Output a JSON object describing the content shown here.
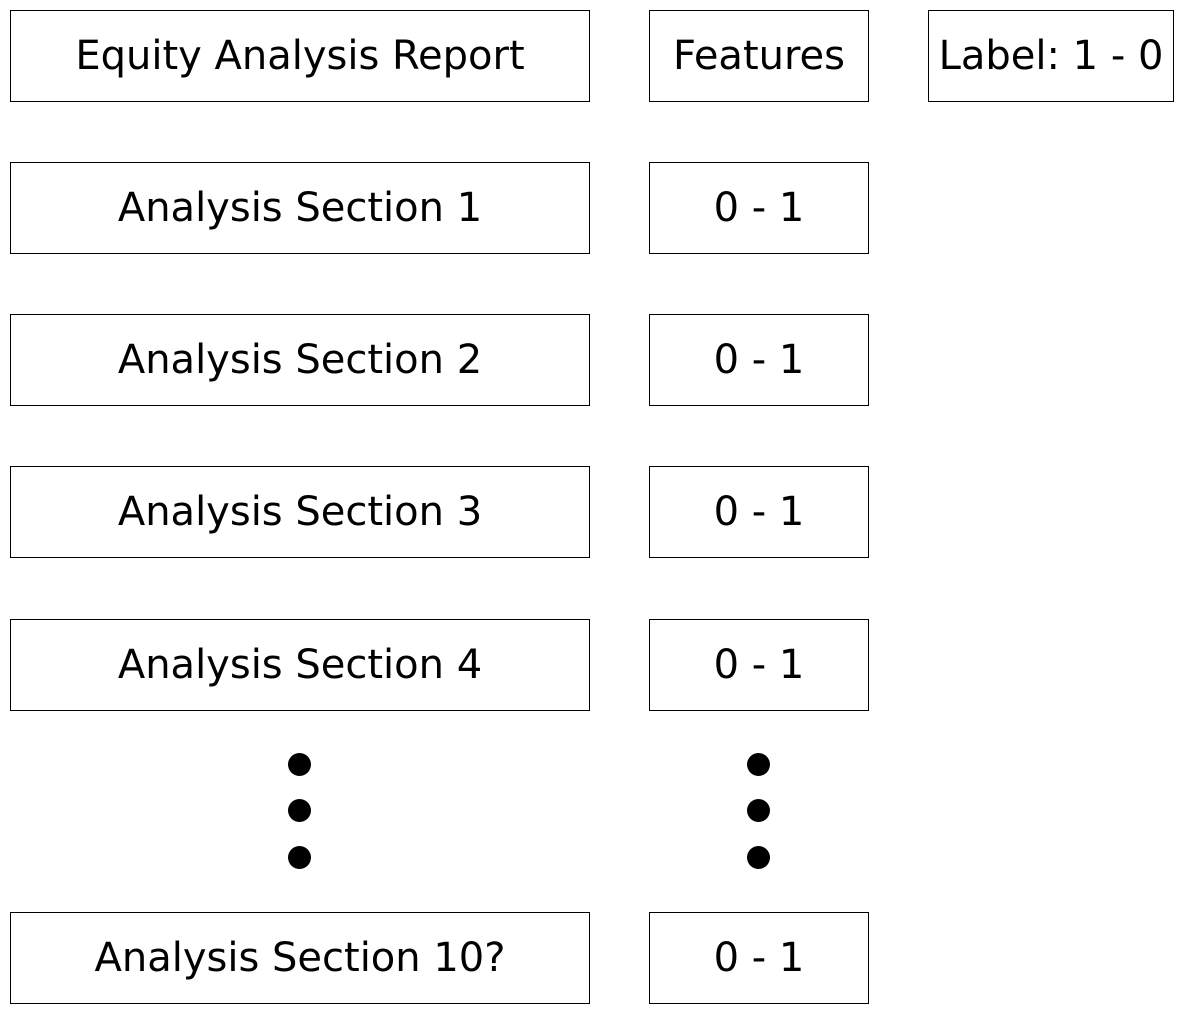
{
  "header": {
    "report": "Equity Analysis Report",
    "features": "Features",
    "label": "Label: 1 - 0"
  },
  "rows": [
    {
      "section": "Analysis Section 1",
      "value": "0 - 1"
    },
    {
      "section": "Analysis Section 2",
      "value": "0 - 1"
    },
    {
      "section": "Analysis Section 3",
      "value": "0 - 1"
    },
    {
      "section": "Analysis Section 4",
      "value": "0 - 1"
    },
    {
      "section": "Analysis Section 10?",
      "value": "0 - 1"
    }
  ]
}
